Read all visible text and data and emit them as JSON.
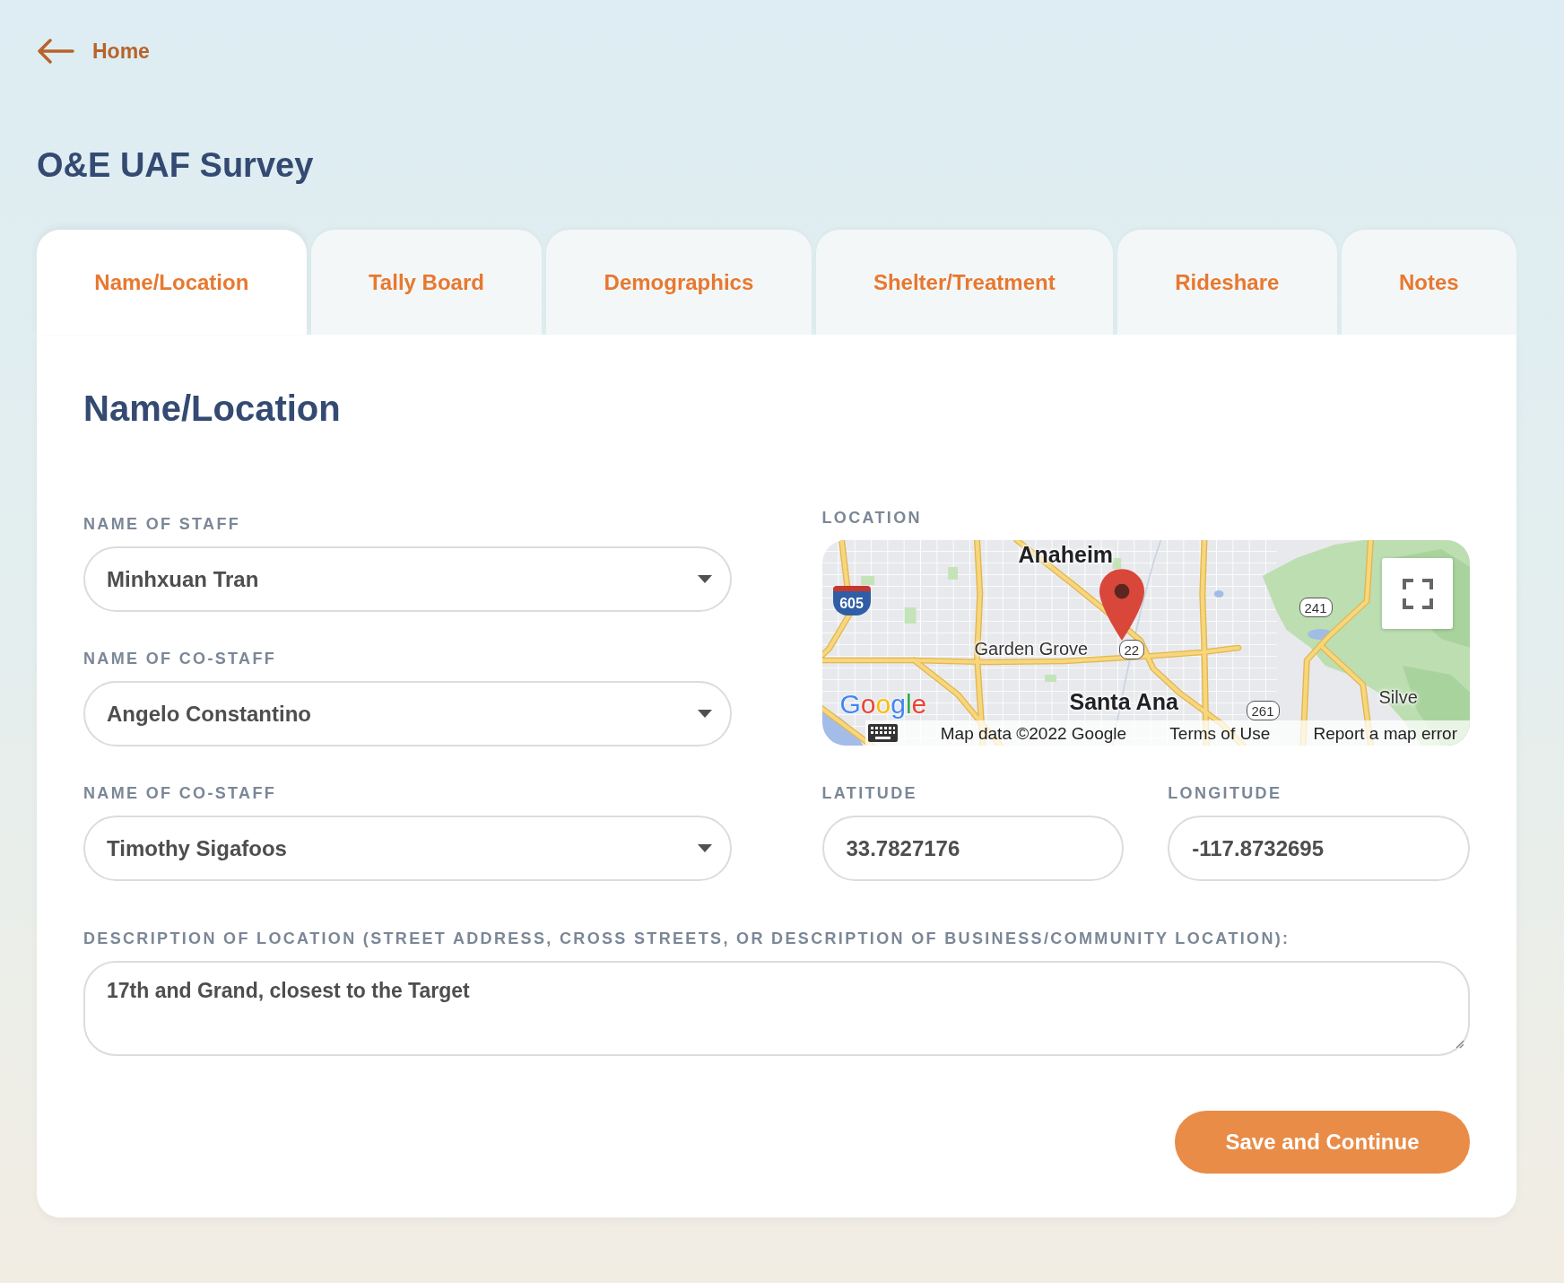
{
  "back_link": {
    "label": "Home"
  },
  "page_title": "O&E UAF Survey",
  "tabs": [
    {
      "label": "Name/Location",
      "selected": true
    },
    {
      "label": "Tally Board",
      "selected": false
    },
    {
      "label": "Demographics",
      "selected": false
    },
    {
      "label": "Shelter/Treatment",
      "selected": false
    },
    {
      "label": "Rideshare",
      "selected": false
    },
    {
      "label": "Notes",
      "selected": false
    }
  ],
  "section": {
    "title": "Name/Location",
    "staff_fields": [
      {
        "label": "NAME OF STAFF",
        "value": "Minhxuan Tran"
      },
      {
        "label": "NAME OF CO-STAFF",
        "value": "Angelo Constantino"
      },
      {
        "label": "NAME OF CO-STAFF",
        "value": "Timothy Sigafoos"
      }
    ],
    "location": {
      "label": "LOCATION",
      "map": {
        "places": [
          {
            "name": "Anaheim",
            "kind": "city"
          },
          {
            "name": "Garden Grove",
            "kind": "town"
          },
          {
            "name": "Santa Ana",
            "kind": "city"
          },
          {
            "name": "Silve",
            "kind": "town"
          }
        ],
        "route_signs": [
          {
            "number": "605",
            "kind": "interstate"
          },
          {
            "number": "22",
            "kind": "state"
          },
          {
            "number": "241",
            "kind": "state"
          },
          {
            "number": "261",
            "kind": "state"
          }
        ],
        "logo": "Google",
        "attribution": "Map data ©2022 Google",
        "links": [
          "Terms of Use",
          "Report a map error"
        ]
      }
    },
    "latitude": {
      "label": "LATITUDE",
      "value": "33.7827176"
    },
    "longitude": {
      "label": "LONGITUDE",
      "value": "-117.8732695"
    },
    "description": {
      "label": "DESCRIPTION OF LOCATION (STREET ADDRESS, CROSS STREETS, OR DESCRIPTION OF BUSINESS/COMMUNITY LOCATION):",
      "value": "17th and Grand, closest to the Target"
    },
    "submit_button": "Save and Continue"
  }
}
